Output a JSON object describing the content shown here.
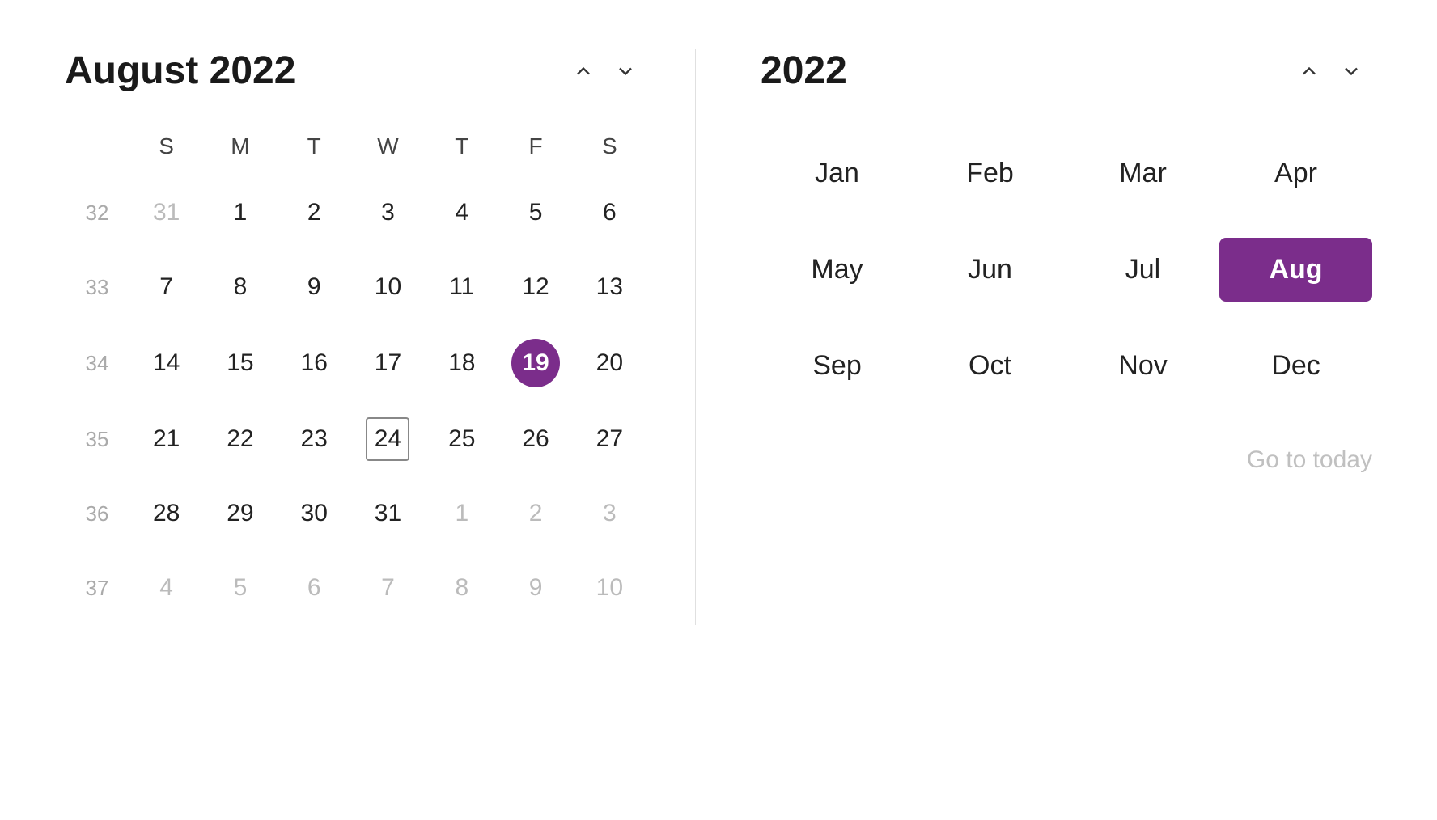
{
  "left": {
    "title": "August 2022",
    "nav": {
      "up_label": "↑",
      "down_label": "↓"
    },
    "day_headers": [
      "S",
      "M",
      "T",
      "W",
      "T",
      "F",
      "S"
    ],
    "weeks": [
      {
        "week_num": "32",
        "days": [
          {
            "num": "31",
            "other": true
          },
          {
            "num": "1",
            "other": false
          },
          {
            "num": "2",
            "other": false
          },
          {
            "num": "3",
            "other": false
          },
          {
            "num": "4",
            "other": false
          },
          {
            "num": "5",
            "other": false
          },
          {
            "num": "6",
            "other": false
          }
        ]
      },
      {
        "week_num": "33",
        "days": [
          {
            "num": "7",
            "other": false
          },
          {
            "num": "8",
            "other": false
          },
          {
            "num": "9",
            "other": false
          },
          {
            "num": "10",
            "other": false
          },
          {
            "num": "11",
            "other": false
          },
          {
            "num": "12",
            "other": false
          },
          {
            "num": "13",
            "other": false
          }
        ]
      },
      {
        "week_num": "34",
        "days": [
          {
            "num": "14",
            "other": false
          },
          {
            "num": "15",
            "other": false
          },
          {
            "num": "16",
            "other": false
          },
          {
            "num": "17",
            "other": false
          },
          {
            "num": "18",
            "other": false
          },
          {
            "num": "19",
            "selected": true,
            "other": false
          },
          {
            "num": "20",
            "other": false
          }
        ]
      },
      {
        "week_num": "35",
        "days": [
          {
            "num": "21",
            "other": false
          },
          {
            "num": "22",
            "other": false
          },
          {
            "num": "23",
            "other": false
          },
          {
            "num": "24",
            "today": true,
            "other": false
          },
          {
            "num": "25",
            "other": false
          },
          {
            "num": "26",
            "other": false
          },
          {
            "num": "27",
            "other": false
          }
        ]
      },
      {
        "week_num": "36",
        "days": [
          {
            "num": "28",
            "other": false
          },
          {
            "num": "29",
            "other": false
          },
          {
            "num": "30",
            "other": false
          },
          {
            "num": "31",
            "other": false
          },
          {
            "num": "1",
            "other": true
          },
          {
            "num": "2",
            "other": true
          },
          {
            "num": "3",
            "other": true
          }
        ]
      },
      {
        "week_num": "37",
        "days": [
          {
            "num": "4",
            "other": true
          },
          {
            "num": "5",
            "other": true
          },
          {
            "num": "6",
            "other": true
          },
          {
            "num": "7",
            "other": true
          },
          {
            "num": "8",
            "other": true
          },
          {
            "num": "9",
            "other": true
          },
          {
            "num": "10",
            "other": true
          }
        ]
      }
    ]
  },
  "right": {
    "title": "2022",
    "nav": {
      "up_label": "↑",
      "down_label": "↓"
    },
    "months": [
      {
        "label": "Jan",
        "active": false
      },
      {
        "label": "Feb",
        "active": false
      },
      {
        "label": "Mar",
        "active": false
      },
      {
        "label": "Apr",
        "active": false
      },
      {
        "label": "May",
        "active": false
      },
      {
        "label": "Jun",
        "active": false
      },
      {
        "label": "Jul",
        "active": false
      },
      {
        "label": "Aug",
        "active": true
      },
      {
        "label": "Sep",
        "active": false
      },
      {
        "label": "Oct",
        "active": false
      },
      {
        "label": "Nov",
        "active": false
      },
      {
        "label": "Dec",
        "active": false
      }
    ],
    "go_today_label": "Go to today"
  },
  "colors": {
    "selected_bg": "#7b2d8b",
    "selected_text": "#ffffff",
    "today_border": "#888888"
  }
}
